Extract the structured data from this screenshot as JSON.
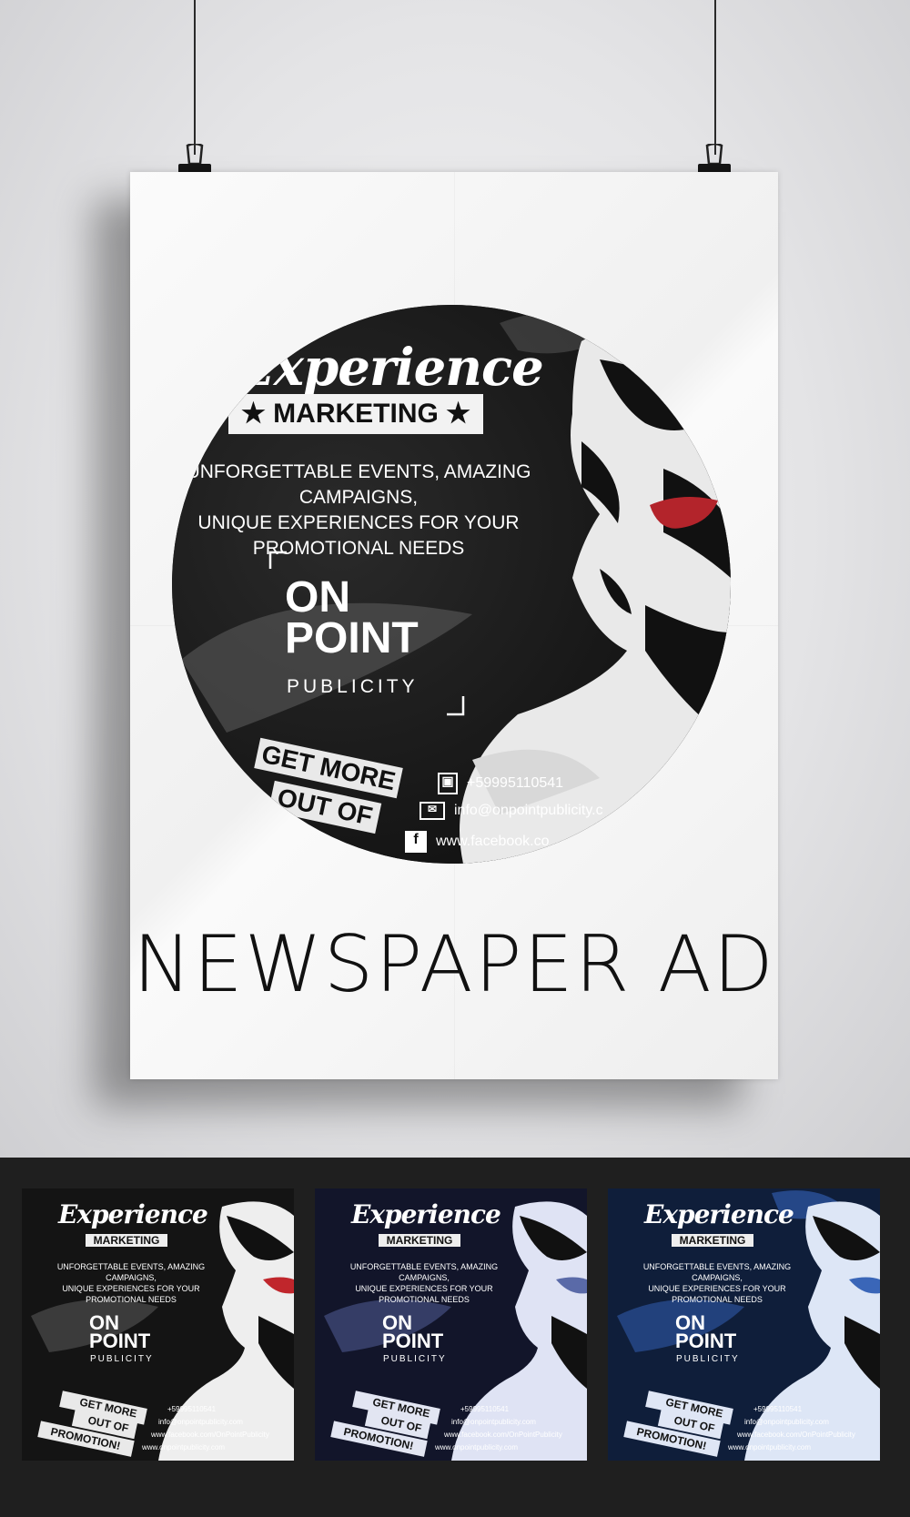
{
  "ad": {
    "experience": "Experience",
    "marketing": "MARKETING",
    "tagline_1": "UNFORGETTABLE EVENTS, AMAZING CAMPAIGNS,",
    "tagline_2": "UNIQUE EXPERIENCES FOR YOUR",
    "tagline_3": "PROMOTIONAL NEEDS",
    "brand_on": "ON",
    "brand_point": "POINT",
    "brand_publicity": "PUBLICITY",
    "banner_1": "GET MORE",
    "banner_2": "OUT OF",
    "banner_3": "PROMOTION!",
    "phone": "+59995110541",
    "email": "info@onpointpublicity.com",
    "facebook": "www.facebook.com/OnPointPublicity",
    "website": "www.onpointpublicity.com"
  },
  "poster_circle": {
    "phone": "+59995110541",
    "email": "info@onpointpublicity.c",
    "facebook": "www.facebook.co",
    "banner_1": "GET MORE",
    "banner_2": "OUT OF"
  },
  "title": "NEWSPAPER AD",
  "variants": [
    {
      "name": "black",
      "bg": "#141414",
      "accent": "#c0262c"
    },
    {
      "name": "navy",
      "bg": "#12152a",
      "accent": "#5a6aa8"
    },
    {
      "name": "blue",
      "bg": "#0f1e3a",
      "accent": "#3a66b8"
    }
  ],
  "colors": {
    "wall": "#e6e6e8",
    "floor": "#1f1f1f",
    "lips": "#b3242b"
  }
}
